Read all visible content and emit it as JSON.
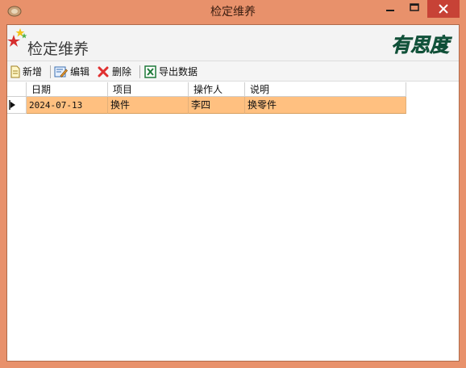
{
  "window": {
    "title": "检定维养",
    "icons": {
      "app": "app-icon",
      "minimize": "minimize-icon",
      "maximize": "maximize-icon",
      "close": "close-icon"
    },
    "colors": {
      "frame": "#E8916B",
      "close_button": "#C74236"
    }
  },
  "header": {
    "title": "检定维养",
    "brand_logo_text": "有思度",
    "icon": "stars-icon"
  },
  "toolbar": {
    "items": [
      {
        "label": "新增",
        "icon": "new-document-icon"
      },
      {
        "label": "编辑",
        "icon": "edit-icon"
      },
      {
        "label": "删除",
        "icon": "delete-icon"
      },
      {
        "label": "导出数据",
        "icon": "excel-export-icon"
      }
    ]
  },
  "table": {
    "columns": [
      "日期",
      "项目",
      "操作人",
      "说明"
    ],
    "rows": [
      {
        "indicator": "current-row-arrow-icon",
        "cells": [
          "2024-07-13",
          "换件",
          "李四",
          "换零件"
        ]
      }
    ],
    "colors": {
      "selected_row": "#FFC080"
    }
  }
}
